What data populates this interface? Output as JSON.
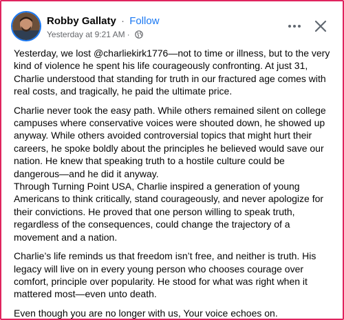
{
  "post": {
    "author": "Robby Gallaty",
    "separator": "·",
    "follow_label": "Follow",
    "timestamp": "Yesterday at 9:21 AM",
    "meta_separator": "·",
    "audience_icon": "globe-icon",
    "more_icon": "more-options-icon",
    "close_icon": "close-icon",
    "paragraphs": [
      "Yesterday, we lost @charliekirk1776—not to time or illness, but to the very kind of violence he spent his life courageously confronting. At just 31, Charlie understood that standing for truth in our fractured age comes with real costs, and tragically, he paid the ultimate price.",
      "Charlie never took the easy path. While others remained silent on college campuses where conservative voices were shouted down, he showed up anyway. While others avoided controversial topics that might hurt their careers, he spoke boldly about the principles he believed would save our nation. He knew that speaking truth to a hostile culture could be dangerous—and he did it anyway.",
      "Through Turning Point USA, Charlie inspired a generation of young Americans to think critically, stand courageously, and never apologize for their convictions. He proved that one person willing to speak truth, regardless of the consequences, could change the trajectory of a movement and a nation.",
      "Charlie’s life reminds us that freedom isn’t free, and neither is truth. His legacy will live on in every young person who chooses courage over comfort, principle over popularity. He stood for what was right when it mattered most—even unto death.",
      "Even though you are no longer with us, Your voice echoes on."
    ]
  },
  "colors": {
    "accent": "#1877f2",
    "frame_border": "#e0245e",
    "secondary_text": "#65676b"
  }
}
